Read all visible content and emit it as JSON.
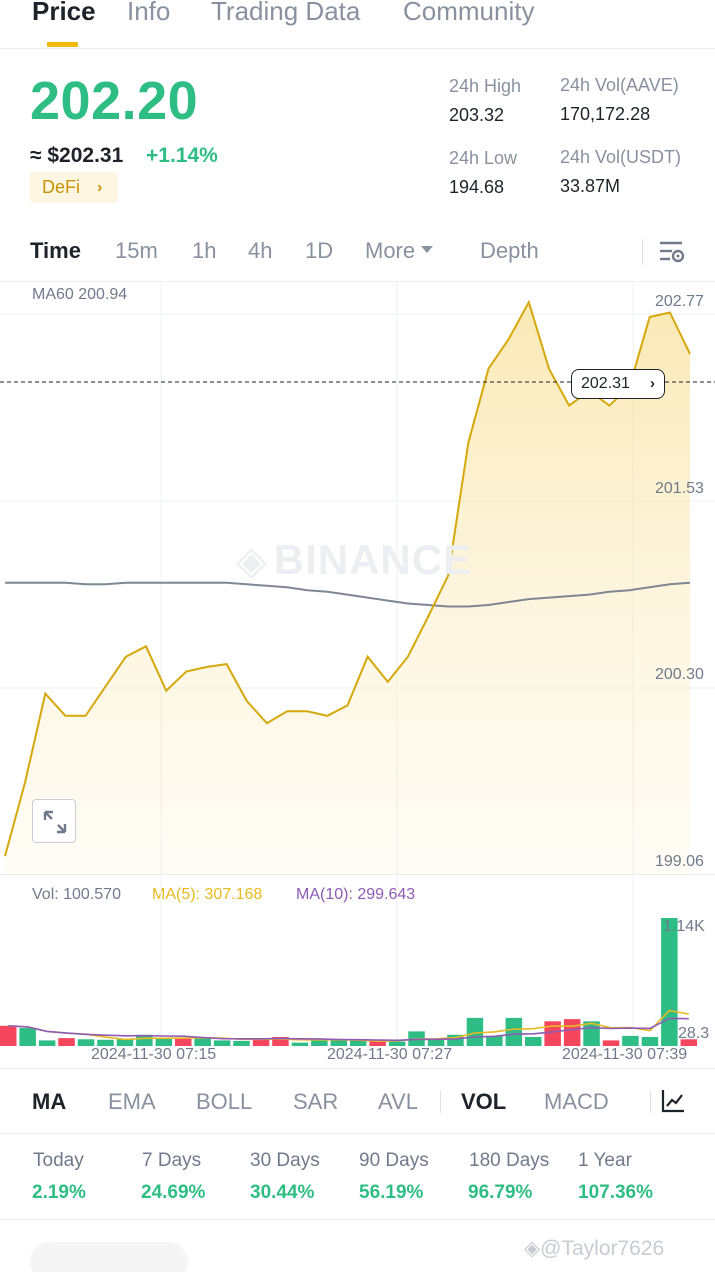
{
  "tabs": [
    "Price",
    "Info",
    "Trading Data",
    "Community"
  ],
  "price": {
    "last": "202.20",
    "fiat": "≈ $202.31",
    "change": "+1.14%",
    "tag": "DeFi",
    "color_up": "#2ebd85",
    "color_down": "#f6465d"
  },
  "stats": {
    "high_label": "24h High",
    "high_value": "203.32",
    "low_label": "24h Low",
    "low_value": "194.68",
    "vol_base_label": "24h Vol(AAVE)",
    "vol_base_value": "170,172.28",
    "vol_quote_label": "24h Vol(USDT)",
    "vol_quote_value": "33.87M"
  },
  "intervals": [
    "Time",
    "15m",
    "1h",
    "4h",
    "1D",
    "More",
    "Depth"
  ],
  "chart": {
    "ma_label": "MA60 200.94",
    "y_ticks": [
      "202.77",
      "201.53",
      "200.30",
      "199.06"
    ],
    "current_price_tag": "202.31",
    "watermark": "BINANCE",
    "vol_label": "Vol: 100.570",
    "vol_ma5": "MA(5): 307.168",
    "vol_ma10": "MA(10): 299.643",
    "vol_max_tick": "1.14K",
    "vol_min_tick": "28.3",
    "x_ticks": [
      "2024-11-30 07:15",
      "2024-11-30 07:27",
      "2024-11-30 07:39"
    ],
    "line_color": "#d6a80b",
    "ma_color": "#7f8794",
    "vol_ma5_color": "#e8b923",
    "vol_ma10_color": "#8e5bb5"
  },
  "chart_data": {
    "type": "line",
    "series": [
      {
        "values": [
          199.1,
          199.6,
          200.2,
          200.05,
          200.05,
          200.25,
          200.45,
          200.52,
          200.22,
          200.35,
          200.38,
          200.4,
          200.15,
          200.0,
          200.08,
          200.08,
          200.05,
          200.12,
          200.45,
          200.28,
          200.45,
          200.72,
          201.0,
          201.9,
          202.4,
          202.6,
          202.85,
          202.4,
          202.15,
          202.25,
          202.15,
          202.28,
          202.75,
          202.78,
          202.5
        ]
      },
      {
        "values": [
          200.95,
          200.95,
          200.95,
          200.95,
          200.94,
          200.94,
          200.95,
          200.95,
          200.95,
          200.95,
          200.95,
          200.95,
          200.94,
          200.93,
          200.92,
          200.9,
          200.89,
          200.87,
          200.85,
          200.83,
          200.81,
          200.8,
          200.79,
          200.79,
          200.8,
          200.82,
          200.84,
          200.85,
          200.86,
          200.87,
          200.89,
          200.9,
          200.92,
          200.94,
          200.95
        ]
      }
    ],
    "ylim": [
      199.06,
      202.77
    ],
    "volume": {
      "values": [
        180,
        160,
        50,
        70,
        60,
        55,
        60,
        100,
        70,
        65,
        70,
        50,
        45,
        70,
        80,
        30,
        50,
        50,
        50,
        40,
        40,
        130,
        60,
        100,
        250,
        90,
        250,
        80,
        220,
        240,
        220,
        50,
        90,
        80,
        1140,
        60
      ],
      "up": [
        false,
        true,
        true,
        false,
        true,
        true,
        true,
        true,
        true,
        false,
        true,
        true,
        true,
        false,
        false,
        true,
        true,
        true,
        true,
        false,
        true,
        true,
        true,
        true,
        true,
        true,
        true,
        true,
        false,
        false,
        true,
        false,
        true,
        true,
        true,
        false
      ]
    }
  },
  "indicators": [
    "MA",
    "EMA",
    "BOLL",
    "SAR",
    "AVL",
    "VOL",
    "MACD"
  ],
  "performance": [
    {
      "label": "Today",
      "value": "2.19%"
    },
    {
      "label": "7 Days",
      "value": "24.69%"
    },
    {
      "label": "30 Days",
      "value": "30.44%"
    },
    {
      "label": "90 Days",
      "value": "56.19%"
    },
    {
      "label": "180 Days",
      "value": "96.79%"
    },
    {
      "label": "1 Year",
      "value": "107.36%"
    }
  ],
  "footer_watermark": "@Taylor7626"
}
